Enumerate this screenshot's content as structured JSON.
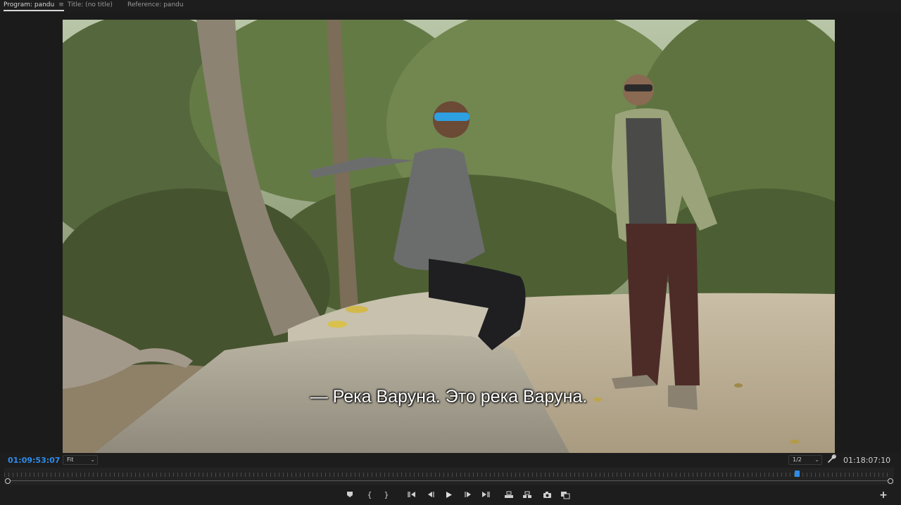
{
  "tabs": [
    {
      "label": "Program: pandu",
      "active": true
    },
    {
      "label": "Title: (no title)",
      "active": false
    },
    {
      "label": "Reference: pandu",
      "active": false
    }
  ],
  "tab_menu_icon": "hamburger-menu-icon",
  "video": {
    "subtitle": "— Река Варуна. Это река Варуна."
  },
  "controls": {
    "current_timecode": "01:09:53:07",
    "zoom_select": "Fit",
    "resolution_select": "1/2",
    "duration_timecode": "01:18:07:10",
    "settings_icon": "wrench-icon"
  },
  "playhead": {
    "position": 0.8905
  },
  "transport": [
    {
      "name": "add-marker-button",
      "icon": "marker-icon"
    },
    {
      "name": "mark-in-button",
      "icon": "mark-in-icon"
    },
    {
      "name": "mark-out-button",
      "icon": "mark-out-icon"
    },
    {
      "name": "go-to-in-button",
      "icon": "go-to-in-icon"
    },
    {
      "name": "step-back-button",
      "icon": "step-back-icon"
    },
    {
      "name": "play-button",
      "icon": "play-icon"
    },
    {
      "name": "step-forward-button",
      "icon": "step-forward-icon"
    },
    {
      "name": "go-to-out-button",
      "icon": "go-to-out-icon"
    },
    {
      "name": "lift-button",
      "icon": "lift-icon"
    },
    {
      "name": "extract-button",
      "icon": "extract-icon"
    },
    {
      "name": "export-frame-button",
      "icon": "camera-icon"
    },
    {
      "name": "comparison-view-button",
      "icon": "comparison-icon"
    }
  ],
  "colors": {
    "accent": "#2d8ceb",
    "background": "#1d1d1d"
  }
}
